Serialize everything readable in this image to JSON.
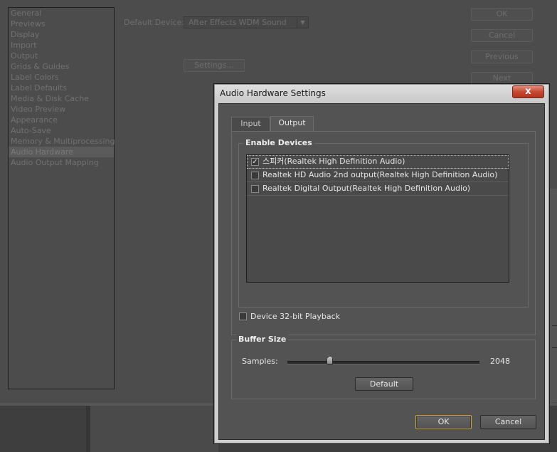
{
  "preferences": {
    "categories": [
      "General",
      "Previews",
      "Display",
      "Import",
      "Output",
      "Grids & Guides",
      "Label Colors",
      "Label Defaults",
      "Media & Disk Cache",
      "Video Preview",
      "Appearance",
      "Auto-Save",
      "Memory & Multiprocessing",
      "Audio Hardware",
      "Audio Output Mapping"
    ],
    "selected_category": "Audio Hardware",
    "default_device_label": "Default Device:",
    "default_device_value": "After Effects WDM Sound",
    "settings_button": "Settings...",
    "ok_button": "OK",
    "cancel_button": "Cancel",
    "previous_button": "Previous",
    "next_button": "Next"
  },
  "dialog": {
    "title": "Audio Hardware Settings",
    "close_glyph": "x",
    "tabs": [
      {
        "label": "Input",
        "active": false
      },
      {
        "label": "Output",
        "active": true
      }
    ],
    "enable_devices": {
      "title": "Enable Devices",
      "devices": [
        {
          "label": "스피커(Realtek High Definition Audio)",
          "checked": true
        },
        {
          "label": "Realtek HD Audio 2nd output(Realtek High Definition Audio)",
          "checked": false
        },
        {
          "label": "Realtek Digital Output(Realtek High Definition Audio)",
          "checked": false
        }
      ]
    },
    "playback_32bit": {
      "label": "Device 32-bit Playback",
      "checked": false
    },
    "buffer_size": {
      "title": "Buffer Size",
      "samples_label": "Samples:",
      "samples_value": "2048",
      "slider_fraction": 0.22,
      "default_button": "Default"
    },
    "ok_button": "OK",
    "cancel_button": "Cancel"
  },
  "colors": {
    "ok_focus_border": "#d1a234",
    "close_button": "#c44a33"
  },
  "icons": {
    "close": "close-icon",
    "checkmark": "checkmark-icon",
    "dropdown": "chevron-down-icon"
  }
}
